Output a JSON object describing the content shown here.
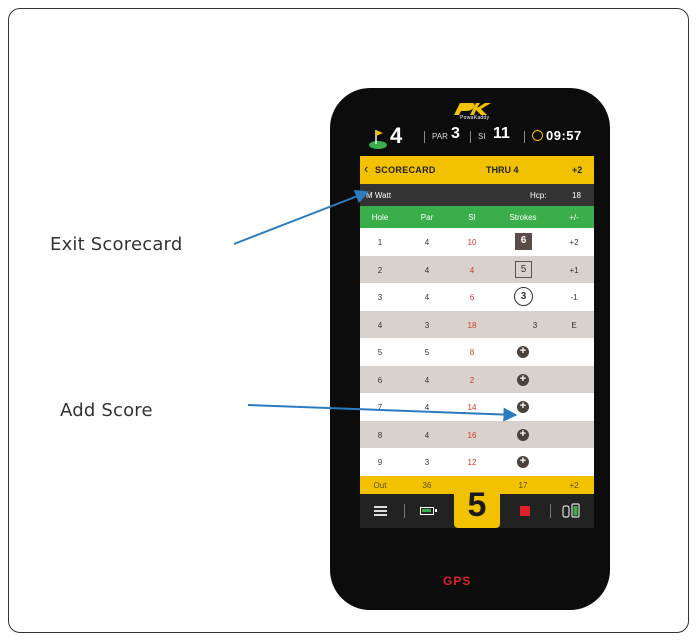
{
  "callouts": {
    "exit_scorecard": "Exit Scorecard",
    "add_score": "Add Score"
  },
  "device": {
    "brand_sub": "PowaKaddy",
    "gps_label": "GPS"
  },
  "topbar": {
    "hole": "4",
    "par_label": "PAR",
    "par_value": "3",
    "si_label": "SI",
    "si_value": "11",
    "time": "09:57",
    "colors": {
      "accent": "#f2c100",
      "flag_green": "#3aae4a"
    }
  },
  "header": {
    "back_icon": "‹",
    "title": "SCORECARD",
    "thru": "THRU 4",
    "total": "+2"
  },
  "player": {
    "name": "M Watt",
    "hcp_label": "Hcp:",
    "hcp_value": "18"
  },
  "columns": [
    "Hole",
    "Par",
    "SI",
    "Strokes",
    "+/-"
  ],
  "rows": [
    {
      "hole": "1",
      "par": "4",
      "si": "10",
      "strokes": "6",
      "style": "dark",
      "diff": "+2"
    },
    {
      "hole": "2",
      "par": "4",
      "si": "4",
      "strokes": "5",
      "style": "outline",
      "diff": "+1"
    },
    {
      "hole": "3",
      "par": "4",
      "si": "6",
      "strokes": "3",
      "style": "circle",
      "diff": "-1"
    },
    {
      "hole": "4",
      "par": "3",
      "si": "18",
      "strokes": "3",
      "style": "plain",
      "diff": "E"
    },
    {
      "hole": "5",
      "par": "5",
      "si": "8",
      "strokes": "",
      "style": "add",
      "diff": ""
    },
    {
      "hole": "6",
      "par": "4",
      "si": "2",
      "strokes": "",
      "style": "add",
      "diff": ""
    },
    {
      "hole": "7",
      "par": "4",
      "si": "14",
      "strokes": "",
      "style": "add",
      "diff": ""
    },
    {
      "hole": "8",
      "par": "4",
      "si": "16",
      "strokes": "",
      "style": "add",
      "diff": ""
    },
    {
      "hole": "9",
      "par": "3",
      "si": "12",
      "strokes": "",
      "style": "add",
      "diff": ""
    }
  ],
  "footer": {
    "label": "Out",
    "par_total": "36",
    "strokes_total": "17",
    "diff_total": "+2"
  },
  "navbar": {
    "current_hole": "5",
    "icons": [
      "menu-icon",
      "battery-icon",
      "stop-icon",
      "trolley-battery-icon"
    ]
  }
}
